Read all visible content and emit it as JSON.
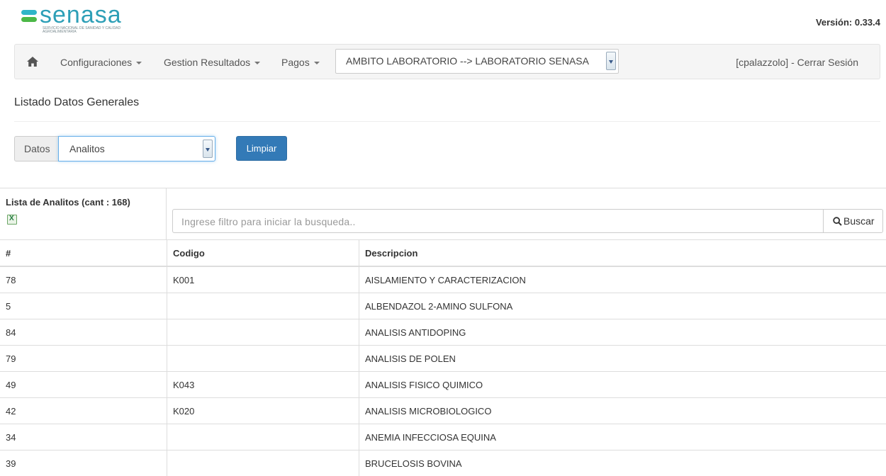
{
  "header": {
    "brand": "senasa",
    "brand_subtitle": "SERVICIO NACIONAL DE SANIDAD Y CALIDAD AGROALIMENTARIA",
    "version_label": "Versión: 0.33.4"
  },
  "navbar": {
    "home_icon": "home-icon",
    "items": [
      {
        "label": "Configuraciones"
      },
      {
        "label": "Gestion Resultados"
      },
      {
        "label": "Pagos"
      }
    ],
    "ambito_value": "AMBITO LABORATORIO --> LABORATORIO SENASA",
    "session_label": "[cpalazzolo] - Cerrar Sesión"
  },
  "page": {
    "title": "Listado Datos Generales"
  },
  "filters": {
    "datos_label": "Datos",
    "datos_value": "Analitos",
    "clear_label": "Limpiar"
  },
  "list": {
    "title": "Lista de Analitos (cant : 168)",
    "search_placeholder": "Ingrese filtro para iniciar la busqueda..",
    "search_button": "Buscar",
    "columns": [
      "#",
      "Codigo",
      "Descripcion"
    ],
    "rows": [
      [
        "78",
        "K001",
        "AISLAMIENTO Y CARACTERIZACION"
      ],
      [
        "5",
        "",
        "ALBENDAZOL 2-AMINO SULFONA"
      ],
      [
        "84",
        "",
        "ANALISIS ANTIDOPING"
      ],
      [
        "79",
        "",
        "ANALISIS DE POLEN"
      ],
      [
        "49",
        "K043",
        "ANALISIS FISICO QUIMICO"
      ],
      [
        "42",
        "K020",
        "ANALISIS MICROBIOLOGICO"
      ],
      [
        "34",
        "",
        "ANEMIA INFECCIOSA EQUINA"
      ],
      [
        "39",
        "",
        "BRUCELOSIS BOVINA"
      ]
    ]
  },
  "colors": {
    "primary": "#337ab7",
    "brand_blue": "#2d9fb7",
    "brand_green": "#4cb848"
  }
}
